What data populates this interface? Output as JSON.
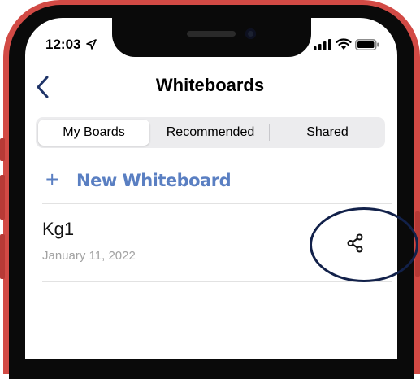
{
  "status_bar": {
    "time": "12:03",
    "location_icon": "location-arrow-icon",
    "signal_icon": "cellular-signal-icon",
    "wifi_icon": "wifi-icon",
    "battery_icon": "battery-icon"
  },
  "header": {
    "title": "Whiteboards",
    "back_icon": "chevron-left-icon"
  },
  "tabs": [
    {
      "label": "My Boards",
      "selected": true
    },
    {
      "label": "Recommended",
      "selected": false
    },
    {
      "label": "Shared",
      "selected": false
    }
  ],
  "new_whiteboard": {
    "icon": "plus-icon",
    "label": "New Whiteboard"
  },
  "boards": [
    {
      "name": "Kg1",
      "date": "January 11, 2022",
      "action_icon": "share-icon"
    }
  ],
  "colors": {
    "frame": "#d24a45",
    "accent": "#5a7fc2",
    "annotation": "#12214a",
    "segment_bg": "#ececee"
  }
}
